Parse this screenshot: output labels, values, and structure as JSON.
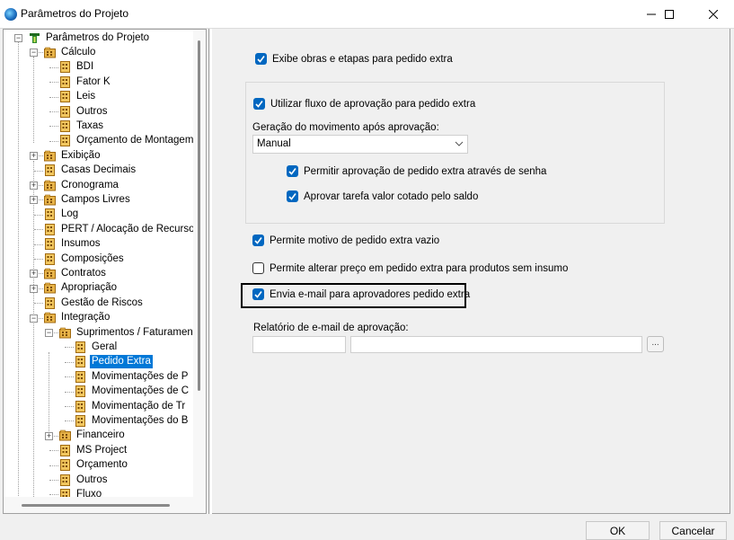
{
  "window": {
    "title": "Parâmetros do Projeto",
    "min_icon": "minimize-icon",
    "max_icon": "maximize-icon",
    "close_icon": "close-icon"
  },
  "tree": {
    "nodes": [
      {
        "label": "Parâmetros do Projeto",
        "icon": "project-root-icon",
        "expanded": true
      },
      {
        "label": "Cálculo",
        "icon": "folder-icon",
        "expanded": true
      },
      {
        "label": "BDI",
        "icon": "page-icon"
      },
      {
        "label": "Fator K",
        "icon": "page-icon"
      },
      {
        "label": "Leis",
        "icon": "page-icon"
      },
      {
        "label": "Outros",
        "icon": "page-icon"
      },
      {
        "label": "Taxas",
        "icon": "page-icon"
      },
      {
        "label": "Orçamento de Montagem",
        "icon": "page-icon"
      },
      {
        "label": "Exibição",
        "icon": "folder-icon",
        "expanded": false
      },
      {
        "label": "Casas Decimais",
        "icon": "page-icon"
      },
      {
        "label": "Cronograma",
        "icon": "folder-icon",
        "expanded": false
      },
      {
        "label": "Campos Livres",
        "icon": "folder-icon",
        "expanded": false
      },
      {
        "label": "Log",
        "icon": "page-icon"
      },
      {
        "label": "PERT / Alocação de Recursos",
        "icon": "page-icon"
      },
      {
        "label": "Insumos",
        "icon": "page-icon"
      },
      {
        "label": "Composições",
        "icon": "page-icon"
      },
      {
        "label": "Contratos",
        "icon": "folder-icon",
        "expanded": false
      },
      {
        "label": "Apropriação",
        "icon": "folder-icon",
        "expanded": false
      },
      {
        "label": "Gestão de Riscos",
        "icon": "page-icon"
      },
      {
        "label": "Integração",
        "icon": "folder-icon",
        "expanded": true
      },
      {
        "label": "Suprimentos / Faturamento",
        "icon": "folder-icon",
        "expanded": true
      },
      {
        "label": "Geral",
        "icon": "page-icon"
      },
      {
        "label": "Pedido Extra",
        "icon": "page-icon",
        "selected": true
      },
      {
        "label": "Movimentações de P",
        "icon": "page-icon"
      },
      {
        "label": "Movimentações de C",
        "icon": "page-icon"
      },
      {
        "label": "Movimentação de Tr",
        "icon": "page-icon"
      },
      {
        "label": "Movimentações do B",
        "icon": "page-icon"
      },
      {
        "label": "Financeiro",
        "icon": "folder-icon",
        "expanded": false
      },
      {
        "label": "MS Project",
        "icon": "page-icon"
      },
      {
        "label": "Orçamento",
        "icon": "page-icon"
      },
      {
        "label": "Outros",
        "icon": "page-icon"
      },
      {
        "label": "Fluxo",
        "icon": "page-icon"
      }
    ]
  },
  "settings": {
    "show_works": {
      "label": "Exibe obras e etapas para pedido extra",
      "checked": true
    },
    "approval_flow": {
      "label": "Utilizar fluxo de aprovação para pedido extra",
      "checked": true
    },
    "movement_label": "Geração do movimento após aprovação:",
    "movement_value": "Manual",
    "allow_password": {
      "label": "Permitir aprovação de pedido extra através de senha",
      "checked": true
    },
    "approve_task": {
      "label": "Aprovar tarefa valor cotado pelo saldo",
      "checked": true
    },
    "empty_reason": {
      "label": "Permite motivo de pedido extra vazio",
      "checked": true
    },
    "change_price": {
      "label": "Permite alterar preço em pedido extra para produtos sem insumo",
      "checked": false
    },
    "send_email": {
      "label": "Envia e-mail para aprovadores pedido extra",
      "checked": true
    },
    "report_label": "Relatório de e-mail de aprovação:",
    "report_code": "",
    "report_name": "",
    "browse_label": "..."
  },
  "footer": {
    "ok": "OK",
    "cancel": "Cancelar"
  },
  "colors": {
    "accent": "#0067c0",
    "selection": "#0078d7"
  }
}
